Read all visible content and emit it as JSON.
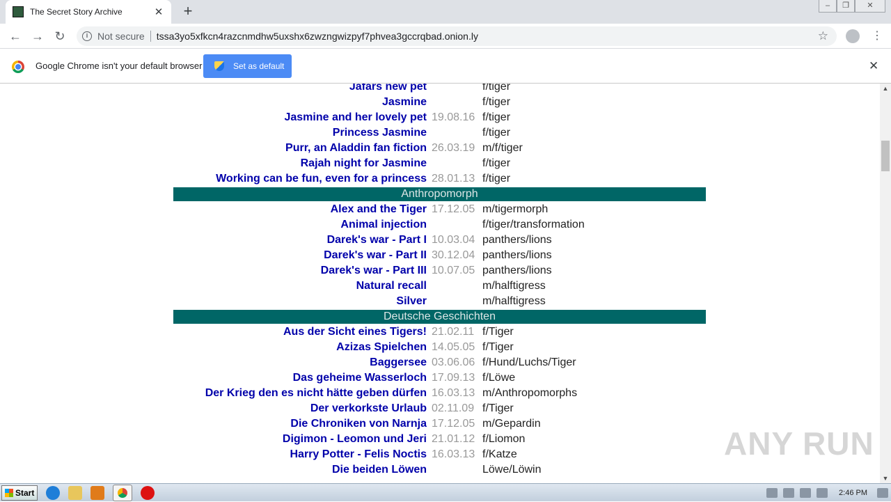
{
  "browser": {
    "tab_title": "The Secret Story Archive",
    "url_status": "Not secure",
    "url": "tssa3yo5xfkcn4razcnmdhw5uxshx6zwzngwizpyf7phvea3gccrqbad.onion.ly",
    "infobar_text": "Google Chrome isn't your default browser",
    "set_default_label": "Set as default"
  },
  "listing": {
    "group1": [
      {
        "title": "Jafars new pet",
        "date": "",
        "tags": "f/tiger"
      },
      {
        "title": "Jasmine",
        "date": "",
        "tags": "f/tiger"
      },
      {
        "title": "Jasmine and her lovely pet",
        "date": "19.08.16",
        "tags": "f/tiger"
      },
      {
        "title": "Princess Jasmine",
        "date": "",
        "tags": "f/tiger"
      },
      {
        "title": "Purr, an Aladdin fan fiction",
        "date": "26.03.19",
        "tags": "m/f/tiger"
      },
      {
        "title": "Rajah night for Jasmine",
        "date": "",
        "tags": "f/tiger"
      },
      {
        "title": "Working can be fun, even for a princess",
        "date": "28.01.13",
        "tags": "f/tiger"
      }
    ],
    "section2": "Anthropomorph",
    "group2": [
      {
        "title": "Alex and the Tiger",
        "date": "17.12.05",
        "tags": "m/tigermorph"
      },
      {
        "title": "Animal injection",
        "date": "",
        "tags": "f/tiger/transformation"
      },
      {
        "title": "Darek's war - Part I",
        "date": "10.03.04",
        "tags": "panthers/lions"
      },
      {
        "title": "Darek's war - Part II",
        "date": "30.12.04",
        "tags": "panthers/lions"
      },
      {
        "title": "Darek's war - Part III",
        "date": "10.07.05",
        "tags": "panthers/lions"
      },
      {
        "title": "Natural recall",
        "date": "",
        "tags": "m/halftigress"
      },
      {
        "title": "Silver",
        "date": "",
        "tags": "m/halftigress"
      }
    ],
    "section3": "Deutsche Geschichten",
    "group3": [
      {
        "title": "Aus der Sicht eines Tigers!",
        "date": "21.02.11",
        "tags": "f/Tiger"
      },
      {
        "title": "Azizas Spielchen",
        "date": "14.05.05",
        "tags": "f/Tiger"
      },
      {
        "title": "Baggersee",
        "date": "03.06.06",
        "tags": "f/Hund/Luchs/Tiger"
      },
      {
        "title": "Das geheime Wasserloch",
        "date": "17.09.13",
        "tags": "f/Löwe"
      },
      {
        "title": "Der Krieg den es nicht hätte geben dürfen",
        "date": "16.03.13",
        "tags": "m/Anthropomorphs"
      },
      {
        "title": "Der verkorkste Urlaub",
        "date": "02.11.09",
        "tags": "f/Tiger"
      },
      {
        "title": "Die Chroniken von Narnja",
        "date": "17.12.05",
        "tags": "m/Gepardin"
      },
      {
        "title": "Digimon - Leomon und Jeri",
        "date": "21.01.12",
        "tags": "f/Liomon"
      },
      {
        "title": "Harry Potter - Felis Noctis",
        "date": "16.03.13",
        "tags": "f/Katze"
      },
      {
        "title": "Die beiden Löwen",
        "date": "",
        "tags": "Löwe/Löwin"
      }
    ]
  },
  "watermark": "ANY RUN",
  "taskbar": {
    "start_label": "Start",
    "clock": "2:46 PM"
  }
}
